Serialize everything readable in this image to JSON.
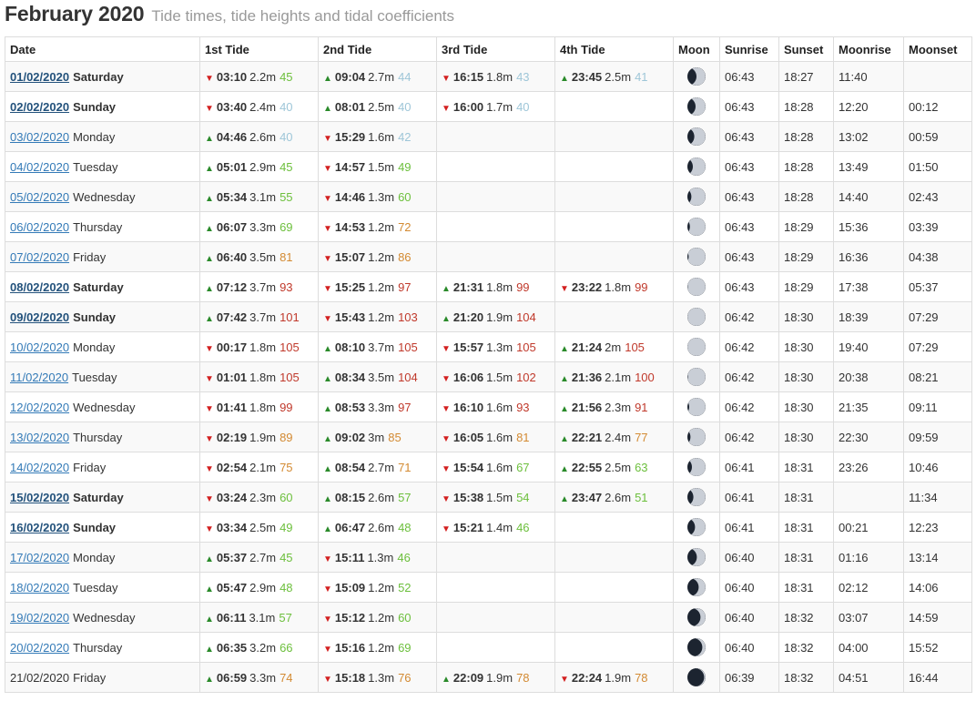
{
  "page": {
    "title": "February 2020",
    "subtitle": "Tide times, tide heights and tidal coefficients"
  },
  "colors": {
    "coef_low": "#9ec6d8",
    "coef_mid_low": "#6cbf3c",
    "coef_mid": "#d38a32",
    "coef_high": "#c0392b",
    "arrow_up": "#2a8a2a",
    "arrow_down": "#d32020"
  },
  "icons": {
    "rising": "triangle-up-icon",
    "falling": "triangle-down-icon",
    "moon": "moon-phase-icon"
  },
  "columns": [
    "Date",
    "1st Tide",
    "2nd Tide",
    "3rd Tide",
    "4th Tide",
    "Moon",
    "Sunrise",
    "Sunset",
    "Moonrise",
    "Moonset"
  ],
  "rows": [
    {
      "date": "01/02/2020",
      "day": "Saturday",
      "bold": true,
      "phase": 0.5,
      "tides": [
        {
          "dir": "down",
          "time": "03:10",
          "height": "2.2m",
          "coef": "45"
        },
        {
          "dir": "up",
          "time": "09:04",
          "height": "2.7m",
          "coef": "44"
        },
        {
          "dir": "down",
          "time": "16:15",
          "height": "1.8m",
          "coef": "43"
        },
        {
          "dir": "up",
          "time": "23:45",
          "height": "2.5m",
          "coef": "41"
        }
      ],
      "sunrise": "06:43",
      "sunset": "18:27",
      "moonrise": "11:40",
      "moonset": ""
    },
    {
      "date": "02/02/2020",
      "day": "Sunday",
      "bold": true,
      "phase": 0.55,
      "tides": [
        {
          "dir": "down",
          "time": "03:40",
          "height": "2.4m",
          "coef": "40"
        },
        {
          "dir": "up",
          "time": "08:01",
          "height": "2.5m",
          "coef": "40"
        },
        {
          "dir": "down",
          "time": "16:00",
          "height": "1.7m",
          "coef": "40"
        },
        null
      ],
      "sunrise": "06:43",
      "sunset": "18:28",
      "moonrise": "12:20",
      "moonset": "00:12"
    },
    {
      "date": "03/02/2020",
      "day": "Monday",
      "bold": false,
      "phase": 0.62,
      "tides": [
        {
          "dir": "up",
          "time": "04:46",
          "height": "2.6m",
          "coef": "40"
        },
        {
          "dir": "down",
          "time": "15:29",
          "height": "1.6m",
          "coef": "42"
        },
        null,
        null
      ],
      "sunrise": "06:43",
      "sunset": "18:28",
      "moonrise": "13:02",
      "moonset": "00:59"
    },
    {
      "date": "04/02/2020",
      "day": "Tuesday",
      "bold": false,
      "phase": 0.7,
      "tides": [
        {
          "dir": "up",
          "time": "05:01",
          "height": "2.9m",
          "coef": "45"
        },
        {
          "dir": "down",
          "time": "14:57",
          "height": "1.5m",
          "coef": "49"
        },
        null,
        null
      ],
      "sunrise": "06:43",
      "sunset": "18:28",
      "moonrise": "13:49",
      "moonset": "01:50"
    },
    {
      "date": "05/02/2020",
      "day": "Wednesday",
      "bold": false,
      "phase": 0.78,
      "tides": [
        {
          "dir": "up",
          "time": "05:34",
          "height": "3.1m",
          "coef": "55"
        },
        {
          "dir": "down",
          "time": "14:46",
          "height": "1.3m",
          "coef": "60"
        },
        null,
        null
      ],
      "sunrise": "06:43",
      "sunset": "18:28",
      "moonrise": "14:40",
      "moonset": "02:43"
    },
    {
      "date": "06/02/2020",
      "day": "Thursday",
      "bold": false,
      "phase": 0.86,
      "tides": [
        {
          "dir": "up",
          "time": "06:07",
          "height": "3.3m",
          "coef": "69"
        },
        {
          "dir": "down",
          "time": "14:53",
          "height": "1.2m",
          "coef": "72"
        },
        null,
        null
      ],
      "sunrise": "06:43",
      "sunset": "18:29",
      "moonrise": "15:36",
      "moonset": "03:39"
    },
    {
      "date": "07/02/2020",
      "day": "Friday",
      "bold": false,
      "phase": 0.93,
      "tides": [
        {
          "dir": "up",
          "time": "06:40",
          "height": "3.5m",
          "coef": "81"
        },
        {
          "dir": "down",
          "time": "15:07",
          "height": "1.2m",
          "coef": "86"
        },
        null,
        null
      ],
      "sunrise": "06:43",
      "sunset": "18:29",
      "moonrise": "16:36",
      "moonset": "04:38"
    },
    {
      "date": "08/02/2020",
      "day": "Saturday",
      "bold": true,
      "phase": 0.98,
      "tides": [
        {
          "dir": "up",
          "time": "07:12",
          "height": "3.7m",
          "coef": "93"
        },
        {
          "dir": "down",
          "time": "15:25",
          "height": "1.2m",
          "coef": "97"
        },
        {
          "dir": "up",
          "time": "21:31",
          "height": "1.8m",
          "coef": "99"
        },
        {
          "dir": "down",
          "time": "23:22",
          "height": "1.8m",
          "coef": "99"
        }
      ],
      "sunrise": "06:43",
      "sunset": "18:29",
      "moonrise": "17:38",
      "moonset": "05:37"
    },
    {
      "date": "09/02/2020",
      "day": "Sunday",
      "bold": true,
      "phase": 1.0,
      "tides": [
        {
          "dir": "up",
          "time": "07:42",
          "height": "3.7m",
          "coef": "101"
        },
        {
          "dir": "down",
          "time": "15:43",
          "height": "1.2m",
          "coef": "103"
        },
        {
          "dir": "up",
          "time": "21:20",
          "height": "1.9m",
          "coef": "104"
        },
        null
      ],
      "sunrise": "06:42",
      "sunset": "18:30",
      "moonrise": "18:39",
      "moonset": "07:29"
    },
    {
      "date": "10/02/2020",
      "day": "Monday",
      "bold": false,
      "phase": 1.0,
      "tides": [
        {
          "dir": "down",
          "time": "00:17",
          "height": "1.8m",
          "coef": "105"
        },
        {
          "dir": "up",
          "time": "08:10",
          "height": "3.7m",
          "coef": "105"
        },
        {
          "dir": "down",
          "time": "15:57",
          "height": "1.3m",
          "coef": "105"
        },
        {
          "dir": "up",
          "time": "21:24",
          "height": "2m",
          "coef": "105"
        }
      ],
      "sunrise": "06:42",
      "sunset": "18:30",
      "moonrise": "19:40",
      "moonset": "07:29"
    },
    {
      "date": "11/02/2020",
      "day": "Tuesday",
      "bold": false,
      "phase": 0.97,
      "tides": [
        {
          "dir": "down",
          "time": "01:01",
          "height": "1.8m",
          "coef": "105"
        },
        {
          "dir": "up",
          "time": "08:34",
          "height": "3.5m",
          "coef": "104"
        },
        {
          "dir": "down",
          "time": "16:06",
          "height": "1.5m",
          "coef": "102"
        },
        {
          "dir": "up",
          "time": "21:36",
          "height": "2.1m",
          "coef": "100"
        }
      ],
      "sunrise": "06:42",
      "sunset": "18:30",
      "moonrise": "20:38",
      "moonset": "08:21"
    },
    {
      "date": "12/02/2020",
      "day": "Wednesday",
      "bold": false,
      "phase": 0.9,
      "tides": [
        {
          "dir": "down",
          "time": "01:41",
          "height": "1.8m",
          "coef": "99"
        },
        {
          "dir": "up",
          "time": "08:53",
          "height": "3.3m",
          "coef": "97"
        },
        {
          "dir": "down",
          "time": "16:10",
          "height": "1.6m",
          "coef": "93"
        },
        {
          "dir": "up",
          "time": "21:56",
          "height": "2.3m",
          "coef": "91"
        }
      ],
      "sunrise": "06:42",
      "sunset": "18:30",
      "moonrise": "21:35",
      "moonset": "09:11"
    },
    {
      "date": "13/02/2020",
      "day": "Thursday",
      "bold": false,
      "phase": 0.83,
      "tides": [
        {
          "dir": "down",
          "time": "02:19",
          "height": "1.9m",
          "coef": "89"
        },
        {
          "dir": "up",
          "time": "09:02",
          "height": "3m",
          "coef": "85"
        },
        {
          "dir": "down",
          "time": "16:05",
          "height": "1.6m",
          "coef": "81"
        },
        {
          "dir": "up",
          "time": "22:21",
          "height": "2.4m",
          "coef": "77"
        }
      ],
      "sunrise": "06:42",
      "sunset": "18:30",
      "moonrise": "22:30",
      "moonset": "09:59"
    },
    {
      "date": "14/02/2020",
      "day": "Friday",
      "bold": false,
      "phase": 0.75,
      "tides": [
        {
          "dir": "down",
          "time": "02:54",
          "height": "2.1m",
          "coef": "75"
        },
        {
          "dir": "up",
          "time": "08:54",
          "height": "2.7m",
          "coef": "71"
        },
        {
          "dir": "down",
          "time": "15:54",
          "height": "1.6m",
          "coef": "67"
        },
        {
          "dir": "up",
          "time": "22:55",
          "height": "2.5m",
          "coef": "63"
        }
      ],
      "sunrise": "06:41",
      "sunset": "18:31",
      "moonrise": "23:26",
      "moonset": "10:46"
    },
    {
      "date": "15/02/2020",
      "day": "Saturday",
      "bold": true,
      "phase": 0.67,
      "tides": [
        {
          "dir": "down",
          "time": "03:24",
          "height": "2.3m",
          "coef": "60"
        },
        {
          "dir": "up",
          "time": "08:15",
          "height": "2.6m",
          "coef": "57"
        },
        {
          "dir": "down",
          "time": "15:38",
          "height": "1.5m",
          "coef": "54"
        },
        {
          "dir": "up",
          "time": "23:47",
          "height": "2.6m",
          "coef": "51"
        }
      ],
      "sunrise": "06:41",
      "sunset": "18:31",
      "moonrise": "",
      "moonset": "11:34"
    },
    {
      "date": "16/02/2020",
      "day": "Sunday",
      "bold": true,
      "phase": 0.58,
      "tides": [
        {
          "dir": "down",
          "time": "03:34",
          "height": "2.5m",
          "coef": "49"
        },
        {
          "dir": "up",
          "time": "06:47",
          "height": "2.6m",
          "coef": "48"
        },
        {
          "dir": "down",
          "time": "15:21",
          "height": "1.4m",
          "coef": "46"
        },
        null
      ],
      "sunrise": "06:41",
      "sunset": "18:31",
      "moonrise": "00:21",
      "moonset": "12:23"
    },
    {
      "date": "17/02/2020",
      "day": "Monday",
      "bold": false,
      "phase": 0.48,
      "tides": [
        {
          "dir": "up",
          "time": "05:37",
          "height": "2.7m",
          "coef": "45"
        },
        {
          "dir": "down",
          "time": "15:11",
          "height": "1.3m",
          "coef": "46"
        },
        null,
        null
      ],
      "sunrise": "06:40",
      "sunset": "18:31",
      "moonrise": "01:16",
      "moonset": "13:14"
    },
    {
      "date": "18/02/2020",
      "day": "Tuesday",
      "bold": false,
      "phase": 0.38,
      "tides": [
        {
          "dir": "up",
          "time": "05:47",
          "height": "2.9m",
          "coef": "48"
        },
        {
          "dir": "down",
          "time": "15:09",
          "height": "1.2m",
          "coef": "52"
        },
        null,
        null
      ],
      "sunrise": "06:40",
      "sunset": "18:31",
      "moonrise": "02:12",
      "moonset": "14:06"
    },
    {
      "date": "19/02/2020",
      "day": "Wednesday",
      "bold": false,
      "phase": 0.28,
      "tides": [
        {
          "dir": "up",
          "time": "06:11",
          "height": "3.1m",
          "coef": "57"
        },
        {
          "dir": "down",
          "time": "15:12",
          "height": "1.2m",
          "coef": "60"
        },
        null,
        null
      ],
      "sunrise": "06:40",
      "sunset": "18:32",
      "moonrise": "03:07",
      "moonset": "14:59"
    },
    {
      "date": "20/02/2020",
      "day": "Thursday",
      "bold": false,
      "phase": 0.18,
      "tides": [
        {
          "dir": "up",
          "time": "06:35",
          "height": "3.2m",
          "coef": "66"
        },
        {
          "dir": "down",
          "time": "15:16",
          "height": "1.2m",
          "coef": "69"
        },
        null,
        null
      ],
      "sunrise": "06:40",
      "sunset": "18:32",
      "moonrise": "04:00",
      "moonset": "15:52"
    },
    {
      "date": "21/02/2020",
      "day": "Friday",
      "bold": false,
      "plaindate": true,
      "phase": 0.08,
      "tides": [
        {
          "dir": "up",
          "time": "06:59",
          "height": "3.3m",
          "coef": "74"
        },
        {
          "dir": "down",
          "time": "15:18",
          "height": "1.3m",
          "coef": "76"
        },
        {
          "dir": "up",
          "time": "22:09",
          "height": "1.9m",
          "coef": "78"
        },
        {
          "dir": "down",
          "time": "22:24",
          "height": "1.9m",
          "coef": "78"
        }
      ],
      "sunrise": "06:39",
      "sunset": "18:32",
      "moonrise": "04:51",
      "moonset": "16:44"
    }
  ]
}
